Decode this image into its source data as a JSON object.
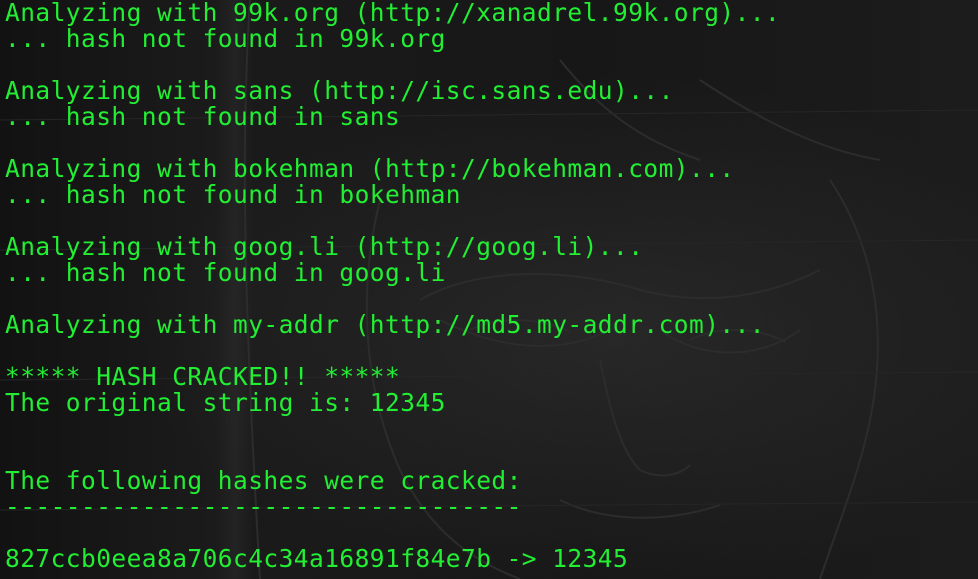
{
  "terminal": {
    "lines": [
      "Analyzing with 99k.org (http://xanadrel.99k.org)...",
      "... hash not found in 99k.org",
      "",
      "Analyzing with sans (http://isc.sans.edu)...",
      "... hash not found in sans",
      "",
      "Analyzing with bokehman (http://bokehman.com)...",
      "... hash not found in bokehman",
      "",
      "Analyzing with goog.li (http://goog.li)...",
      "... hash not found in goog.li",
      "",
      "Analyzing with my-addr (http://md5.my-addr.com)...",
      "",
      "***** HASH CRACKED!! *****",
      "The original string is: 12345",
      "",
      "",
      "The following hashes were cracked:",
      "----------------------------------",
      "",
      "827ccb0eea8a706c4c34a16891f84e7b -> 12345"
    ],
    "text_color": "#22ee33",
    "background_color": "#161616"
  }
}
